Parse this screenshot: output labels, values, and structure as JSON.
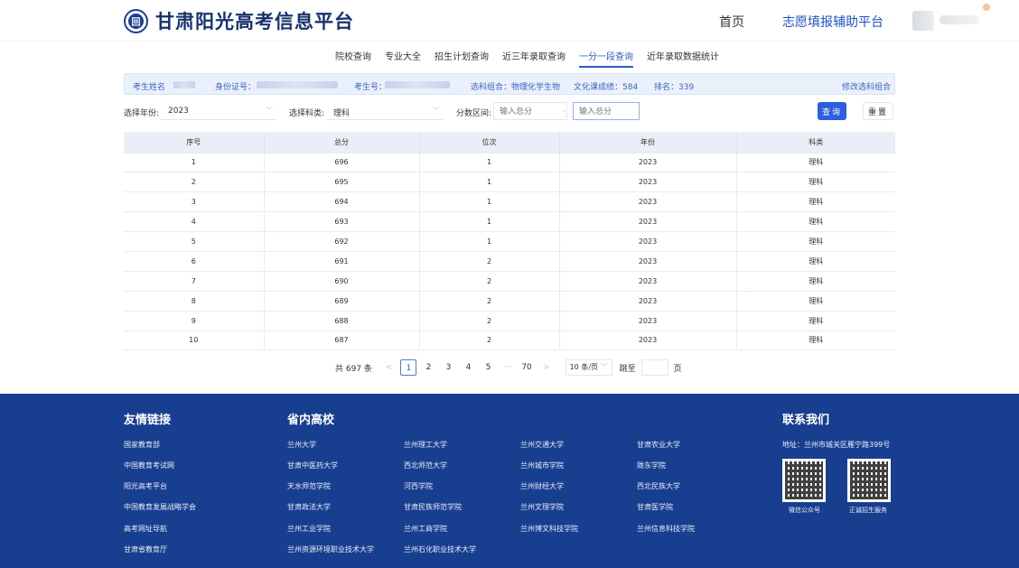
{
  "header": {
    "logo_glyph": "回",
    "title": "甘肃阳光高考信息平台",
    "nav_home": "首页",
    "nav_platform": "志愿填报辅助平台"
  },
  "tabs": [
    {
      "label": "院校查询",
      "active": false
    },
    {
      "label": "专业大全",
      "active": false
    },
    {
      "label": "招生计划查询",
      "active": false
    },
    {
      "label": "近三年录取查询",
      "active": false
    },
    {
      "label": "一分一段查询",
      "active": true
    },
    {
      "label": "近年录取数据统计",
      "active": false
    }
  ],
  "infobar": {
    "name_label": "考生姓名",
    "id_label": "身份证号：",
    "exam_no_label": "考生号：",
    "subjects": "选科组合：物理化学生物",
    "score": "文化课成绩：584",
    "rank": "排名：339",
    "modify_link": "修改选科组合"
  },
  "filters": {
    "year_label": "选择年份:",
    "year_value": "2023",
    "subject_label": "选择科类:",
    "subject_value": "理科",
    "range_label": "分数区间:",
    "min_placeholder": "输入总分",
    "range_sep": "-",
    "max_placeholder": "输入总分",
    "query_button": "查询",
    "reset_button": "重置"
  },
  "table": {
    "headers": [
      "序号",
      "总分",
      "位次",
      "年份",
      "科类"
    ],
    "rows": [
      [
        "1",
        "696",
        "1",
        "2023",
        "理科"
      ],
      [
        "2",
        "695",
        "1",
        "2023",
        "理科"
      ],
      [
        "3",
        "694",
        "1",
        "2023",
        "理科"
      ],
      [
        "4",
        "693",
        "1",
        "2023",
        "理科"
      ],
      [
        "5",
        "692",
        "1",
        "2023",
        "理科"
      ],
      [
        "6",
        "691",
        "2",
        "2023",
        "理科"
      ],
      [
        "7",
        "690",
        "2",
        "2023",
        "理科"
      ],
      [
        "8",
        "689",
        "2",
        "2023",
        "理科"
      ],
      [
        "9",
        "688",
        "2",
        "2023",
        "理科"
      ],
      [
        "10",
        "687",
        "2",
        "2023",
        "理科"
      ]
    ]
  },
  "pagination": {
    "total": "共 697 条",
    "prev": "<",
    "pages": [
      "1",
      "2",
      "3",
      "4",
      "5"
    ],
    "active_page": "1",
    "ellipsis": "···",
    "last_page": "70",
    "next": ">",
    "page_size": "10 条/页",
    "jump_label": "跳至",
    "jump_suffix": "页"
  },
  "footer": {
    "links_title": "友情链接",
    "links": [
      "国家教育部",
      "中国教育考试网",
      "阳光高考平台",
      "中国教育发展战略学会",
      "高考网址导航",
      "甘肃省教育厅"
    ],
    "schools_title": "省内高校",
    "schools_col1": [
      "兰州大学",
      "甘肃中医药大学",
      "天水师范学院",
      "甘肃政法大学",
      "兰州工业学院",
      "兰州资源环境职业技术大学"
    ],
    "schools_col2": [
      "兰州理工大学",
      "西北师范大学",
      "河西学院",
      "甘肃民族师范学院",
      "兰州工商学院",
      "兰州石化职业技术大学"
    ],
    "schools_col3": [
      "兰州交通大学",
      "兰州城市学院",
      "兰州财经大学",
      "兰州文理学院",
      "兰州博文科技学院"
    ],
    "schools_col4": [
      "甘肃农业大学",
      "陇东学院",
      "西北民族大学",
      "甘肃医学院",
      "兰州信息科技学院"
    ],
    "contact_title": "联系我们",
    "address": "地址：兰州市城关区雁宁路399号",
    "qr1_caption": "微信公众号",
    "qr2_caption": "正诚招生服务"
  },
  "colors": {
    "primary": "#2c5fdc",
    "footer_bg": "#183f8f",
    "brand_text": "#17326f"
  }
}
